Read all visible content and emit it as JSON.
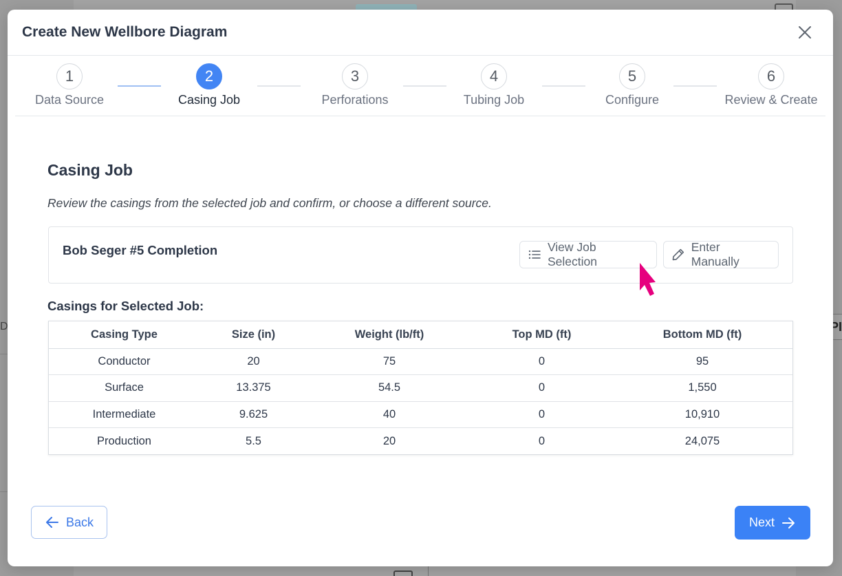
{
  "modal": {
    "title": "Create New Wellbore Diagram"
  },
  "steps": [
    {
      "number": "1",
      "label": "Data Source"
    },
    {
      "number": "2",
      "label": "Casing Job"
    },
    {
      "number": "3",
      "label": "Perforations"
    },
    {
      "number": "4",
      "label": "Tubing Job"
    },
    {
      "number": "5",
      "label": "Configure"
    },
    {
      "number": "6",
      "label": "Review & Create"
    }
  ],
  "section": {
    "title": "Casing Job",
    "description": "Review the casings from the selected job and confirm, or choose a different source."
  },
  "job": {
    "name": "Bob Seger #5 Completion",
    "view_selection_label": "View Job Selection",
    "enter_manually_label": "Enter Manually"
  },
  "casings": {
    "title": "Casings for Selected Job:",
    "headers": [
      "Casing Type",
      "Size (in)",
      "Weight (lb/ft)",
      "Top MD (ft)",
      "Bottom MD (ft)"
    ],
    "rows": [
      [
        "Conductor",
        "20",
        "75",
        "0",
        "95"
      ],
      [
        "Surface",
        "13.375",
        "54.5",
        "0",
        "1,550"
      ],
      [
        "Intermediate",
        "9.625",
        "40",
        "0",
        "10,910"
      ],
      [
        "Production",
        "5.5",
        "20",
        "0",
        "24,075"
      ]
    ]
  },
  "footer": {
    "back_label": "Back",
    "next_label": "Next"
  },
  "background": {
    "right_edge_text": "PI",
    "left_edge_text": "D"
  },
  "colors": {
    "accent": "#3b82f6",
    "cursor": "#e6007e"
  }
}
